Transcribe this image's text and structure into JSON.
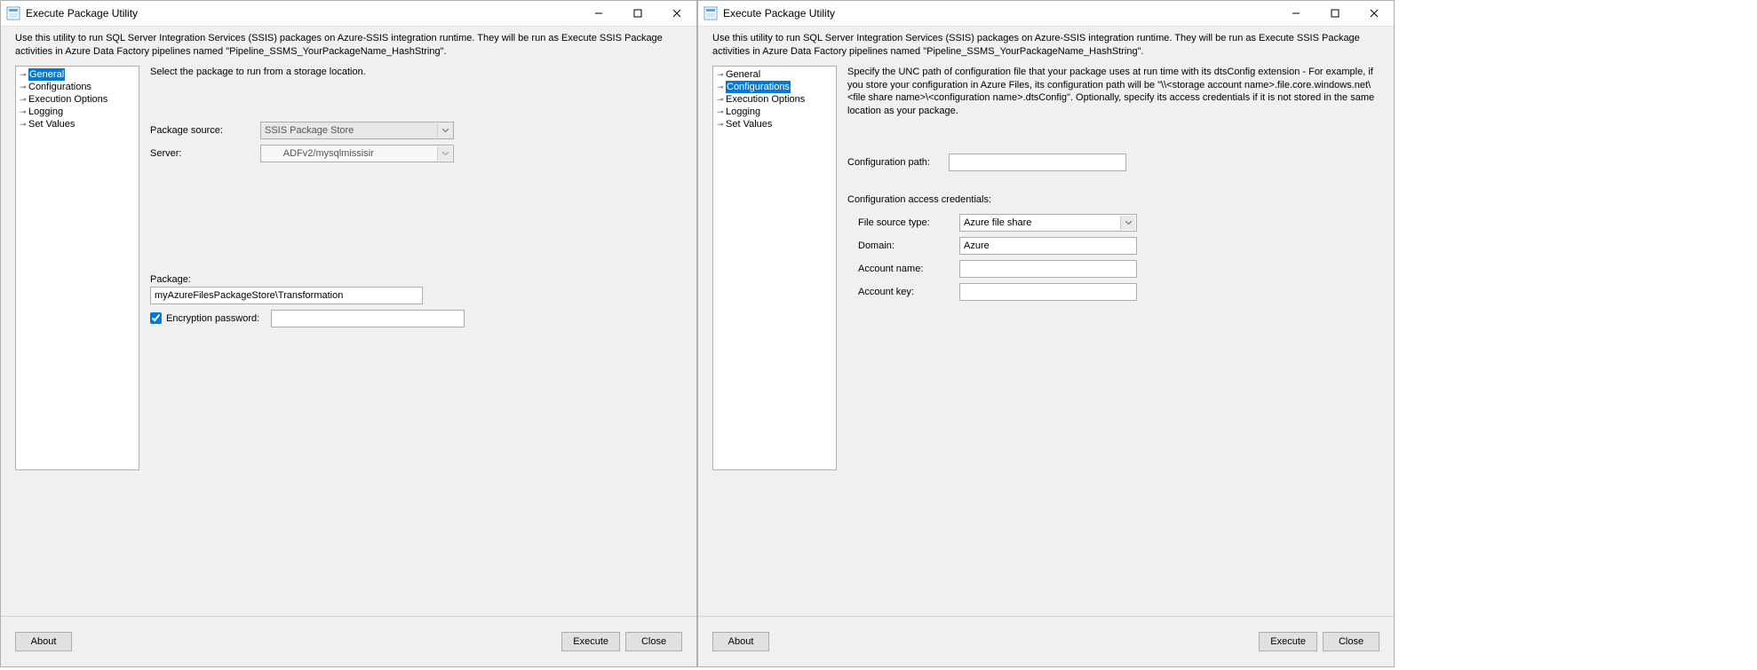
{
  "app_title": "Execute Package Utility",
  "intro": "Use this utility to run SQL Server Integration Services (SSIS) packages on Azure-SSIS integration runtime. They will be run as Execute SSIS Package activities in Azure Data Factory pipelines named \"Pipeline_SSMS_YourPackageName_HashString\".",
  "nav": {
    "items": [
      "General",
      "Configurations",
      "Execution Options",
      "Logging",
      "Set Values"
    ]
  },
  "left": {
    "selected": 0,
    "desc": "Select the package to run from a storage location.",
    "package_source_label": "Package source:",
    "package_source_value": "SSIS Package Store",
    "server_label": "Server:",
    "server_value": "       ADFv2/mysqlmissisir",
    "package_label": "Package:",
    "package_value": "myAzureFilesPackageStore\\Transformation",
    "encryption_label": "Encryption password:",
    "encryption_checked": true
  },
  "right": {
    "selected": 1,
    "desc": "Specify the UNC path of configuration file that your package uses at run time with its dtsConfig extension - For example, if you store your configuration in Azure Files, its configuration path will be \"\\\\<storage account name>.file.core.windows.net\\<file share name>\\<configuration name>.dtsConfig\".  Optionally, specify its access credentials if it is not stored in the same location as your package.",
    "config_path_label": "Configuration path:",
    "config_path_value": "",
    "creds_label": "Configuration access credentials:",
    "file_source_type_label": "File source type:",
    "file_source_type_value": "Azure file share",
    "domain_label": "Domain:",
    "domain_value": "Azure",
    "account_name_label": "Account name:",
    "account_name_value": "",
    "account_key_label": "Account key:",
    "account_key_value": ""
  },
  "buttons": {
    "about": "About",
    "execute": "Execute",
    "close": "Close"
  }
}
